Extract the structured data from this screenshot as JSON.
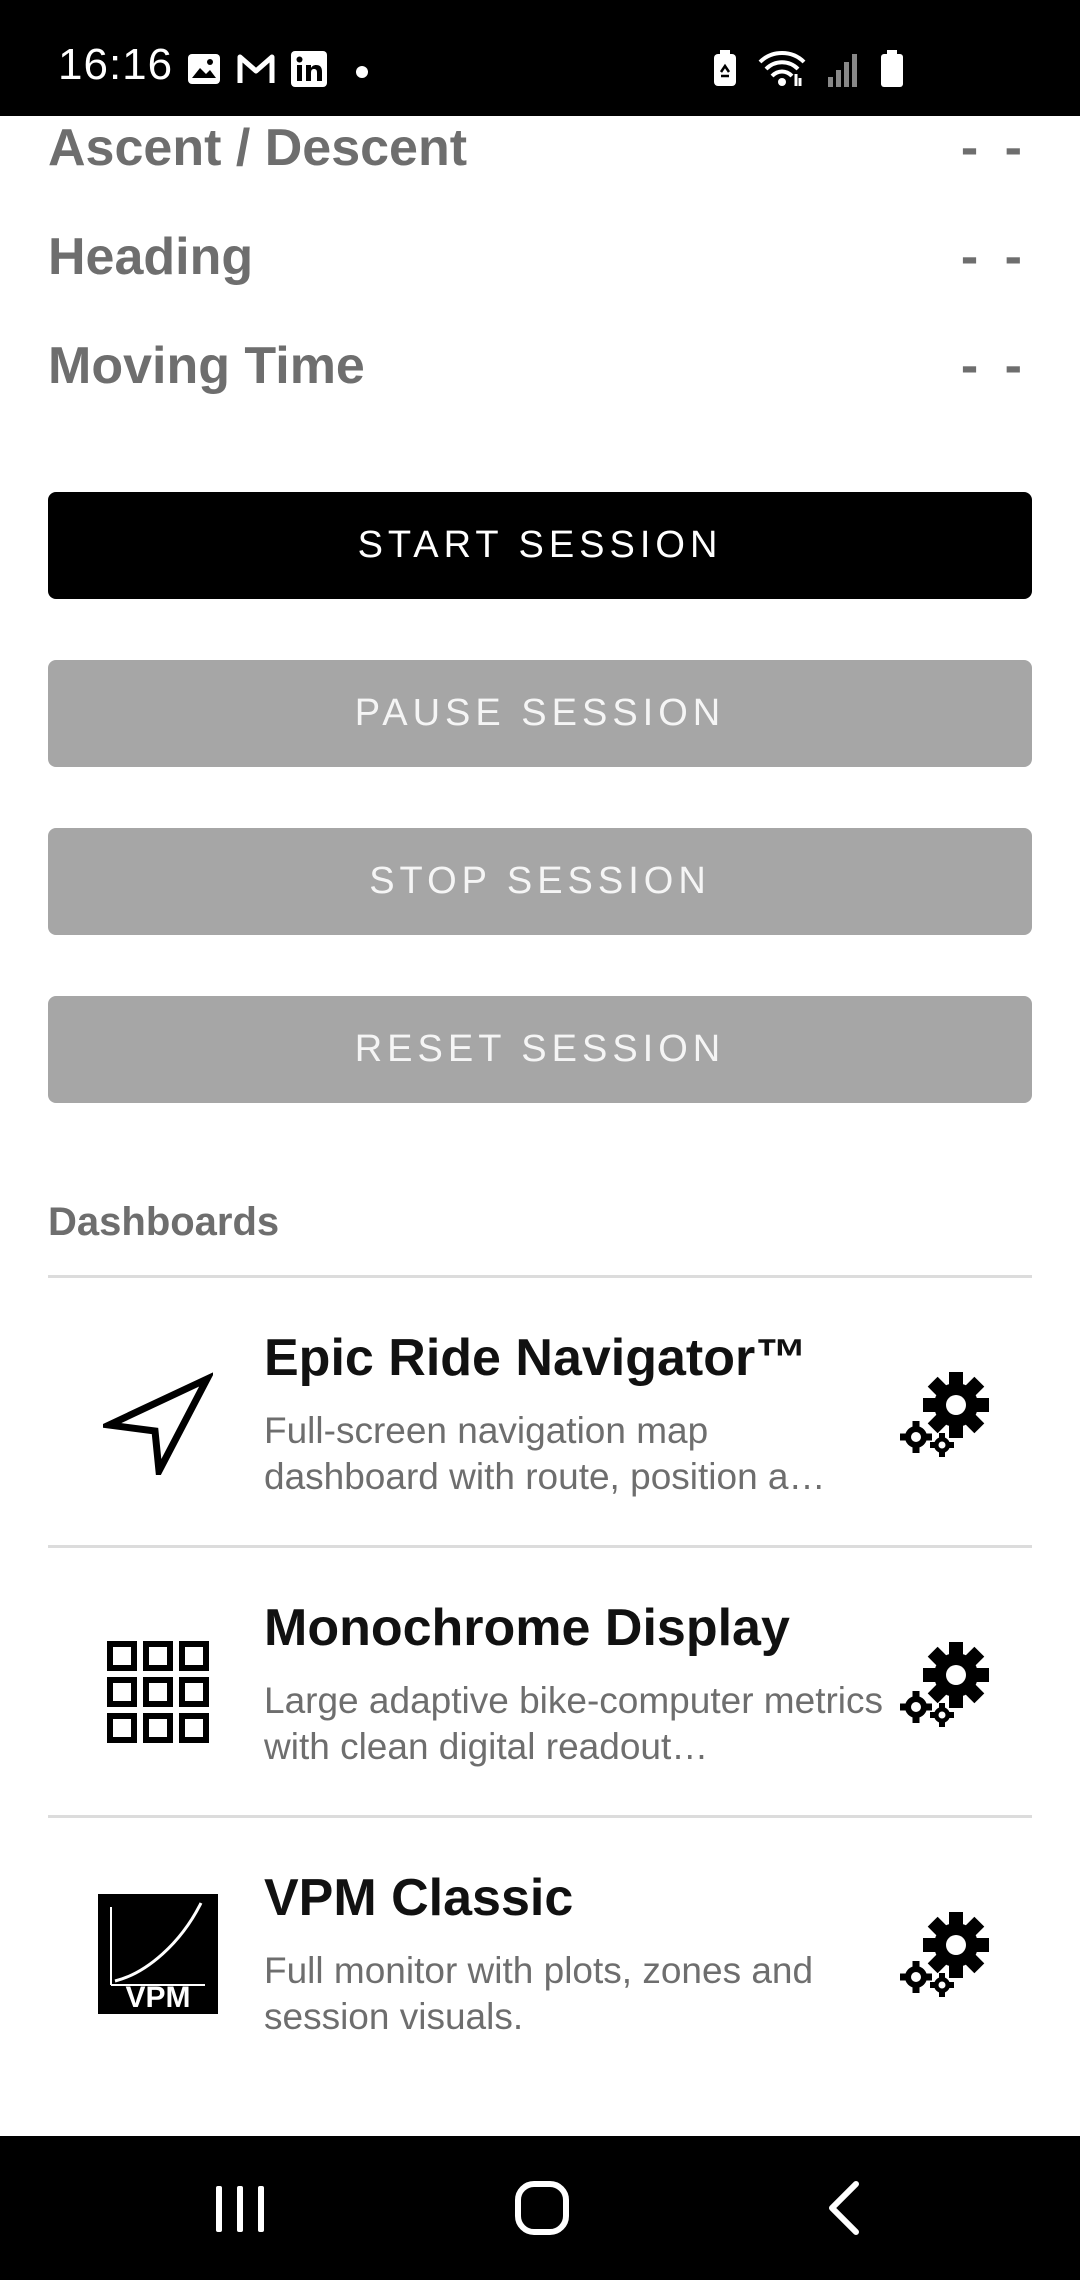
{
  "status_bar": {
    "time": "16:16",
    "left_icons": [
      "gallery-icon",
      "gmail-icon",
      "linkedin-icon",
      "notification-dot-icon"
    ],
    "right_icons": [
      "battery-saver-icon",
      "wifi-icon",
      "signal-icon",
      "battery-icon"
    ]
  },
  "metrics": [
    {
      "label": "Ascent / Descent",
      "value": "- -"
    },
    {
      "label": "Heading",
      "value": "- -"
    },
    {
      "label": "Moving Time",
      "value": "- -"
    }
  ],
  "buttons": {
    "start": "START SESSION",
    "pause": "PAUSE SESSION",
    "stop": "STOP SESSION",
    "reset": "RESET SESSION"
  },
  "dashboards": {
    "section_title": "Dashboards",
    "items": [
      {
        "title": "Epic Ride Navigator™",
        "description": "Full-screen navigation map dashboard with route, position a…",
        "icon": "navigation-arrow-icon"
      },
      {
        "title": "Monochrome Display",
        "description": "Large adaptive bike-computer metrics with clean digital readout…",
        "icon": "grid-icon"
      },
      {
        "title": "VPM Classic",
        "description": "Full monitor with plots, zones and session visuals.",
        "icon": "vpm-logo-icon",
        "logo_text": "VPM"
      }
    ]
  },
  "colors": {
    "primary_button": "#000000",
    "disabled_button": "#a6a6a6",
    "muted_text": "#6e6e6e"
  }
}
